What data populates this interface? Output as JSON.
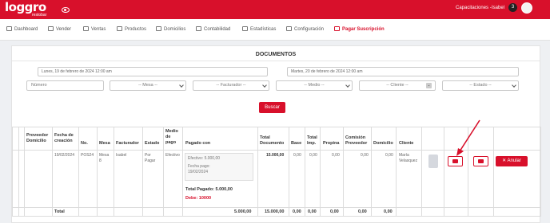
{
  "header": {
    "logo": "loggro",
    "logo_sub": "restobar",
    "capacitaciones": "Capacitaciones -",
    "user": "Isabel",
    "notifications": "3"
  },
  "nav": {
    "items": [
      {
        "label": "Dashboard",
        "icon": "dashboard-icon"
      },
      {
        "label": "Vender",
        "icon": "vender-icon"
      },
      {
        "label": "Ventas",
        "icon": "ventas-icon"
      },
      {
        "label": "Productos",
        "icon": "productos-icon"
      },
      {
        "label": "Domicilios",
        "icon": "domicilios-icon"
      },
      {
        "label": "Contabilidad",
        "icon": "contabilidad-icon"
      },
      {
        "label": "Estadísticas",
        "icon": "estadisticas-icon"
      },
      {
        "label": "Configuración",
        "icon": "configuracion-icon"
      },
      {
        "label": "Pagar Suscripción",
        "icon": "pagar-icon"
      }
    ]
  },
  "panel": {
    "title": "DOCUMENTOS",
    "date_from": "Lunes, 19 de febrero de 2024 12:00 am",
    "date_to": "Martes, 20 de febrero de 2024 12:00 am",
    "numero_placeholder": "Número",
    "mesa": "-- Mesa --",
    "facturador": "-- Facturador --",
    "medio": "-- Medio --",
    "cliente": "-- Cliente --",
    "estado": "-- Estado --",
    "buscar": "Buscar"
  },
  "table": {
    "headers": {
      "proveedor": [
        "Proveedor",
        "Domicilio"
      ],
      "fecha": [
        "Fecha de",
        "creación"
      ],
      "no": "No.",
      "mesa": "Mesa",
      "facturador": "Facturador",
      "estado": "Estado",
      "medio": [
        "Medio",
        "de",
        "pago"
      ],
      "pagado": "Pagado con",
      "total_doc": [
        "Total",
        "Documento"
      ],
      "base": "Base",
      "total_imp": [
        "Total",
        "Imp."
      ],
      "propina": "Propina",
      "comision": [
        "Comisión",
        "Proveedor"
      ],
      "domicilio": "Domicilio",
      "cliente": "Cliente"
    },
    "row": {
      "fecha": "19/02/2024",
      "no": "POS24",
      "mesa": [
        "Mesa",
        "8"
      ],
      "facturador": "Isabel",
      "estado": [
        "Por",
        "Pagar"
      ],
      "medio": "Efectivo",
      "pago_line1": "Efectivo: 5.000,00",
      "pago_line2": "Fecha pago:",
      "pago_line3": "19/02/2024",
      "total_pagado": "Total Pagado: 5.000,00",
      "debe": "Debe: 10000",
      "total_doc": "15.000,00",
      "base": "0,00",
      "total_imp": "0,00",
      "propina": "0,00",
      "comision": "0,00",
      "domicilio": "0,00",
      "cliente": [
        "María",
        "Velasquez"
      ],
      "anular": "Anular"
    },
    "totals": {
      "label": "Total",
      "pagado": "5.000,00",
      "total_doc": "15.000,00",
      "base": "0,00",
      "total_imp": "0,00",
      "propina": "0,00",
      "comision": "0,00",
      "domicilio": "0,00"
    }
  }
}
